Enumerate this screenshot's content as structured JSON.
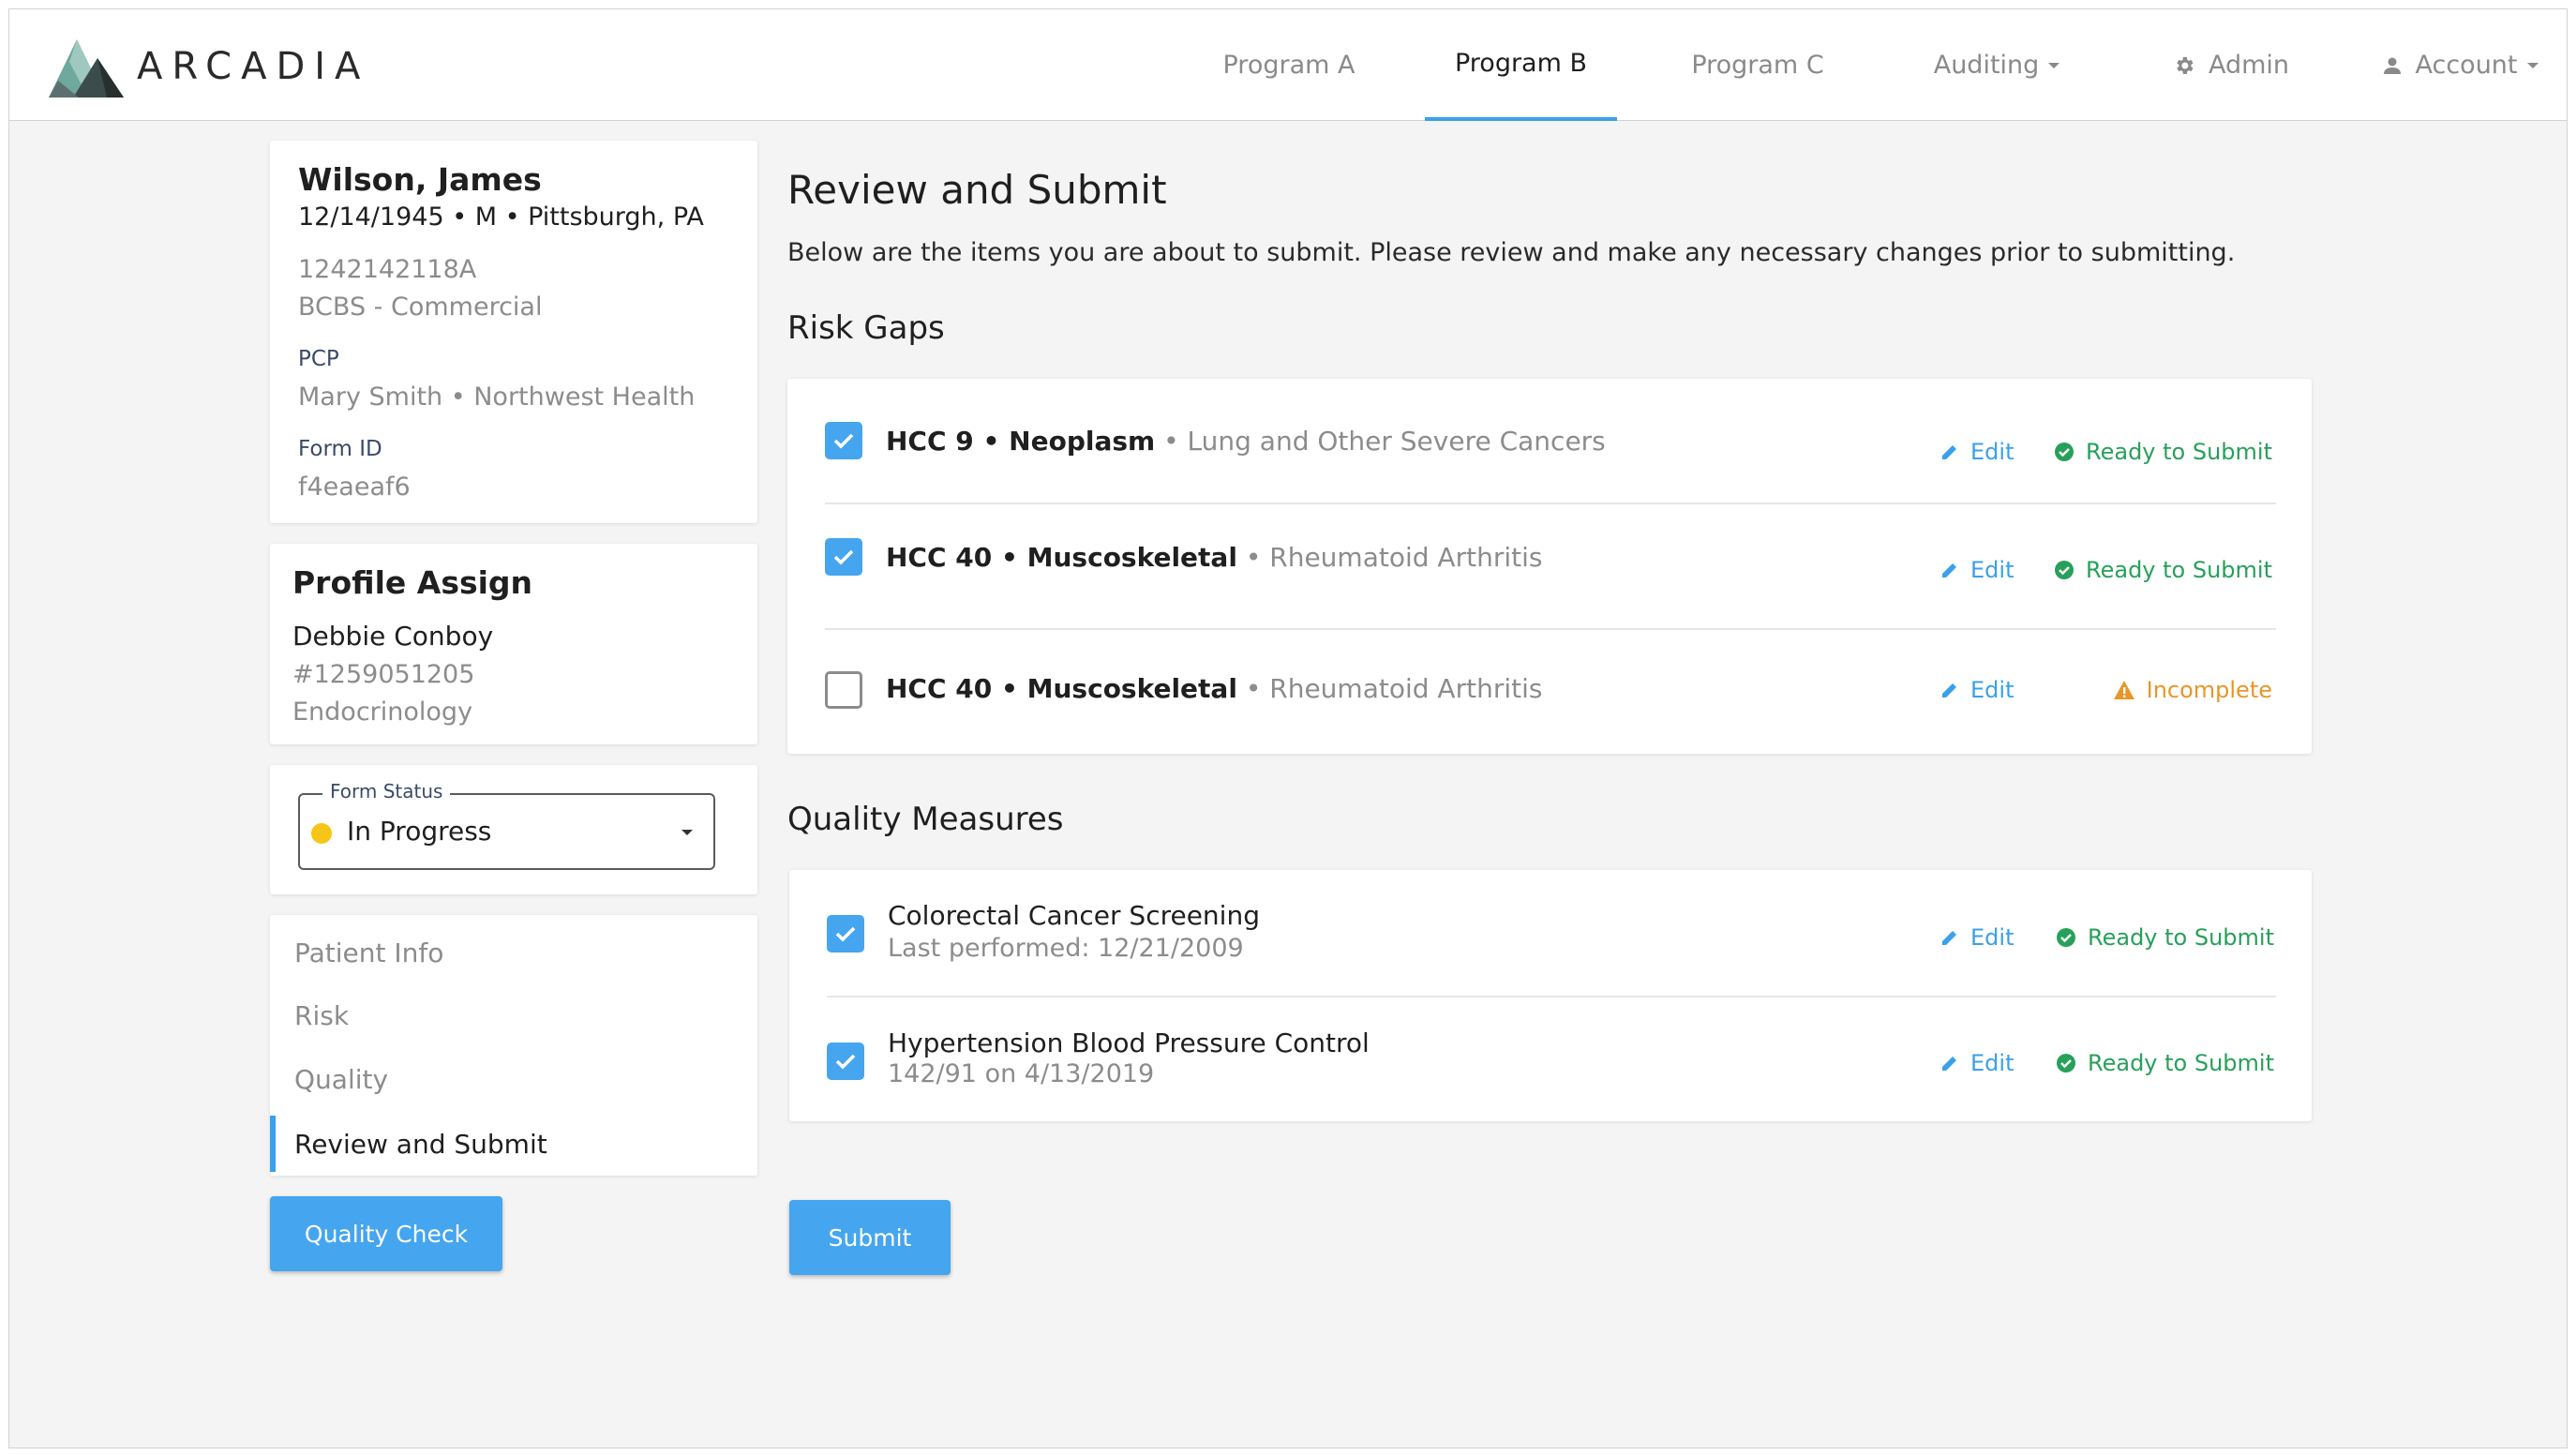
{
  "app": {
    "logo_text": "ARCADIA"
  },
  "nav": {
    "items": [
      {
        "label": "Program A"
      },
      {
        "label": "Program B"
      },
      {
        "label": "Program C"
      },
      {
        "label": "Auditing"
      },
      {
        "label": "Admin"
      },
      {
        "label": "Account"
      }
    ],
    "active": "Program B"
  },
  "patient": {
    "name": "Wilson, James",
    "details": "12/14/1945 • M • Pittsburgh, PA",
    "member_id": "1242142118A",
    "plan": "BCBS - Commercial",
    "pcp_label": "PCP",
    "pcp_value": "Mary Smith • Northwest Health",
    "form_id_label": "Form ID",
    "form_id_value": "f4eaeaf6"
  },
  "profile": {
    "title": "Profile Assign",
    "name": "Debbie Conboy",
    "number": "#1259051205",
    "specialty": "Endocrinology"
  },
  "form_status": {
    "legend": "Form Status",
    "value": "In Progress",
    "dot_color": "#f5c518"
  },
  "side_nav": {
    "items": [
      {
        "label": "Patient Info"
      },
      {
        "label": "Risk"
      },
      {
        "label": "Quality"
      },
      {
        "label": "Review and Submit"
      }
    ],
    "active": "Review and Submit"
  },
  "buttons": {
    "quality_check": "Quality Check",
    "submit": "Submit"
  },
  "main": {
    "title": "Review and Submit",
    "description": "Below are the items you are about to submit. Please review and make any necessary changes prior to submitting.",
    "risk_gaps_title": "Risk Gaps",
    "quality_measures_title": "Quality Measures",
    "edit_label": "Edit"
  },
  "risk_gaps": [
    {
      "code": "HCC 9 • Neoplasm",
      "detail": " • Lung and Other Severe Cancers",
      "checked": true,
      "status": "Ready to Submit"
    },
    {
      "code": "HCC 40 • Muscoskeletal",
      "detail": " • Rheumatoid Arthritis",
      "checked": true,
      "status": "Ready to Submit"
    },
    {
      "code": "HCC 40 • Muscoskeletal",
      "detail": " • Rheumatoid Arthritis",
      "checked": false,
      "status": "Incomplete"
    }
  ],
  "quality_measures": [
    {
      "title": "Colorectal Cancer Screening",
      "detail": "Last performed: 12/21/2009",
      "checked": true,
      "status": "Ready to Submit"
    },
    {
      "title": "Hypertension Blood Pressure Control",
      "detail": "142/91 on 4/13/2019",
      "checked": true,
      "status": "Ready to Submit"
    }
  ],
  "colors": {
    "accent": "#45a5ef",
    "ready": "#27a05a",
    "incomplete": "#e8962a"
  }
}
